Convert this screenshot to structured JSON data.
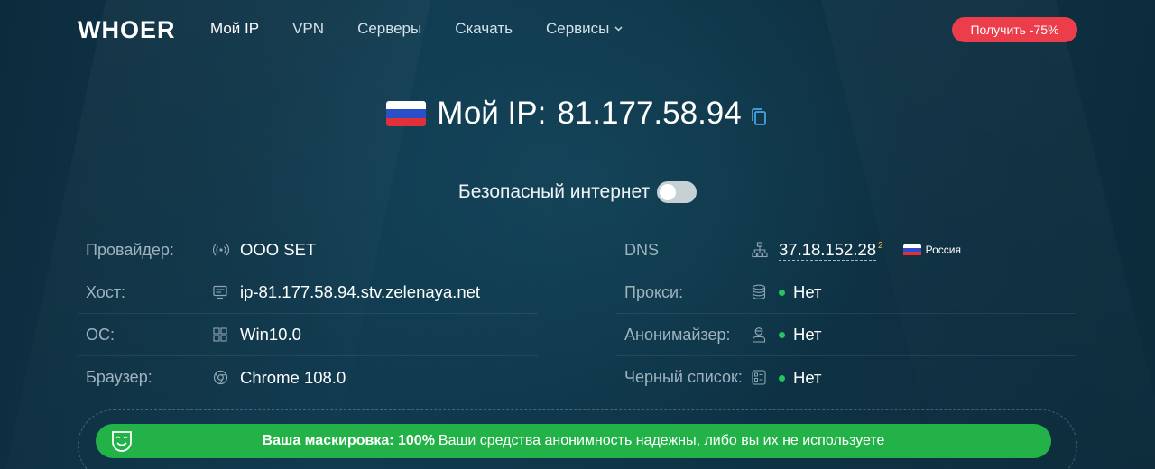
{
  "header": {
    "logo": "WHOER",
    "nav": [
      {
        "label": "Мой IP",
        "active": true
      },
      {
        "label": "VPN"
      },
      {
        "label": "Серверы"
      },
      {
        "label": "Скачать"
      },
      {
        "label": "Сервисы",
        "dropdown": true
      }
    ],
    "promo_label": "Получить -75%"
  },
  "ip": {
    "label": "Мой IP:",
    "value": "81.177.58.94",
    "country_flag": "russia-flag-icon"
  },
  "safe_internet": {
    "label": "Безопасный интернет",
    "enabled": false
  },
  "left_rows": [
    {
      "label": "Провайдер:",
      "icon": "signal-icon",
      "value": "OOO SET"
    },
    {
      "label": "Хост:",
      "icon": "server-icon",
      "value": "ip-81.177.58.94.stv.zelenaya.net"
    },
    {
      "label": "ОС:",
      "icon": "windows-icon",
      "value": "Win10.0"
    },
    {
      "label": "Браузер:",
      "icon": "chrome-icon",
      "value": "Chrome 108.0"
    }
  ],
  "right_rows": [
    {
      "label": "DNS",
      "icon": "network-icon",
      "value": "37.18.152.28",
      "count": "2",
      "country": "Россия"
    },
    {
      "label": "Прокси:",
      "icon": "database-icon",
      "value": "Нет"
    },
    {
      "label": "Анонимайзер:",
      "icon": "user-icon",
      "value": "Нет"
    },
    {
      "label": "Черный список:",
      "icon": "list-icon",
      "value": "Нет"
    }
  ],
  "mask": {
    "title": "Ваша маскировка: 100%",
    "text": "Ваши средства анонимность надежны, либо вы их не используете",
    "color": "#23b248"
  },
  "colors": {
    "background": "#0f3447",
    "promo": "#ec3d4b",
    "status_ok": "#22c55e",
    "dns_count": "#f5c242"
  }
}
